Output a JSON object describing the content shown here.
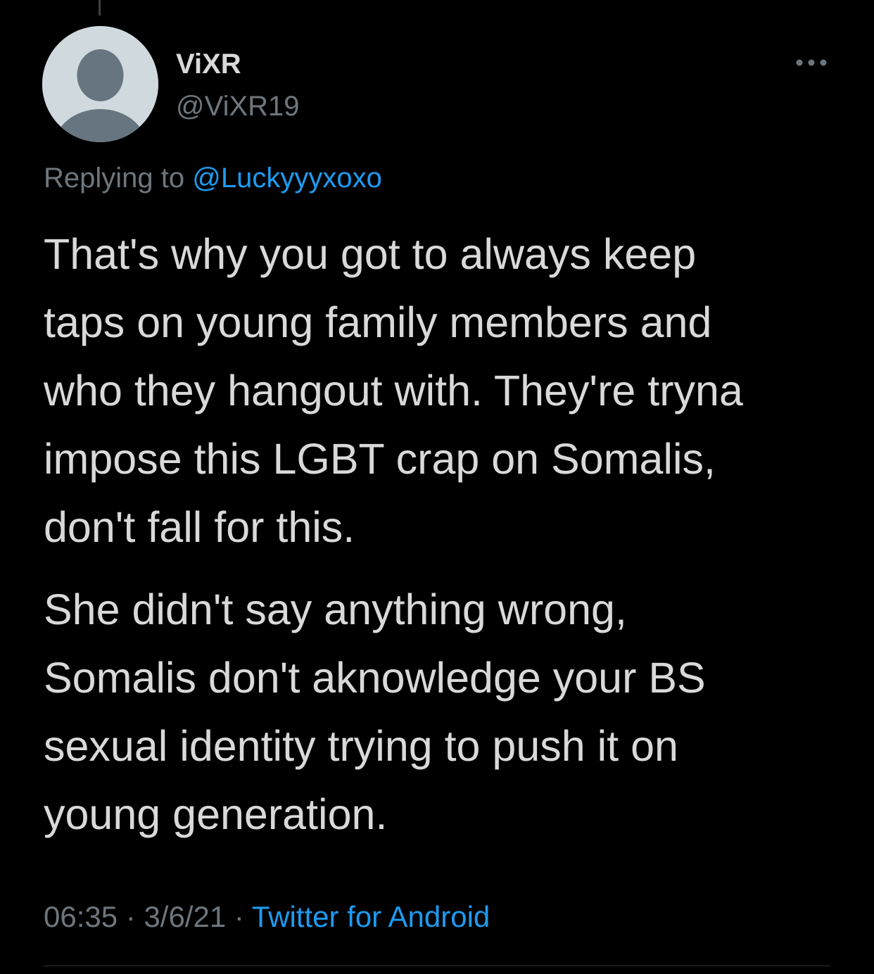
{
  "tweet": {
    "author": {
      "display_name": "ViXR",
      "handle": "@ViXR19",
      "avatar_icon": "default-avatar-icon"
    },
    "more_icon": "more-horizontal-icon",
    "reply": {
      "prefix": "Replying to ",
      "handle": "@Luckyyyxoxo"
    },
    "paragraphs": [
      "That's why you got to always keep\ntaps on young family members and\nwho they hangout with. They're tryna\nimpose this LGBT crap on Somalis,\ndon't fall for this.",
      "She didn't say anything wrong,\nSomalis don't aknowledge your BS\nsexual identity trying to push it on\nyoung generation."
    ],
    "meta": {
      "time": "06:35",
      "separator": " · ",
      "date": "3/6/21",
      "source": "Twitter for Android"
    }
  },
  "colors": {
    "background": "#000000",
    "text": "#d9d9d9",
    "secondary": "#6e767d",
    "link": "#1d9bf0"
  }
}
